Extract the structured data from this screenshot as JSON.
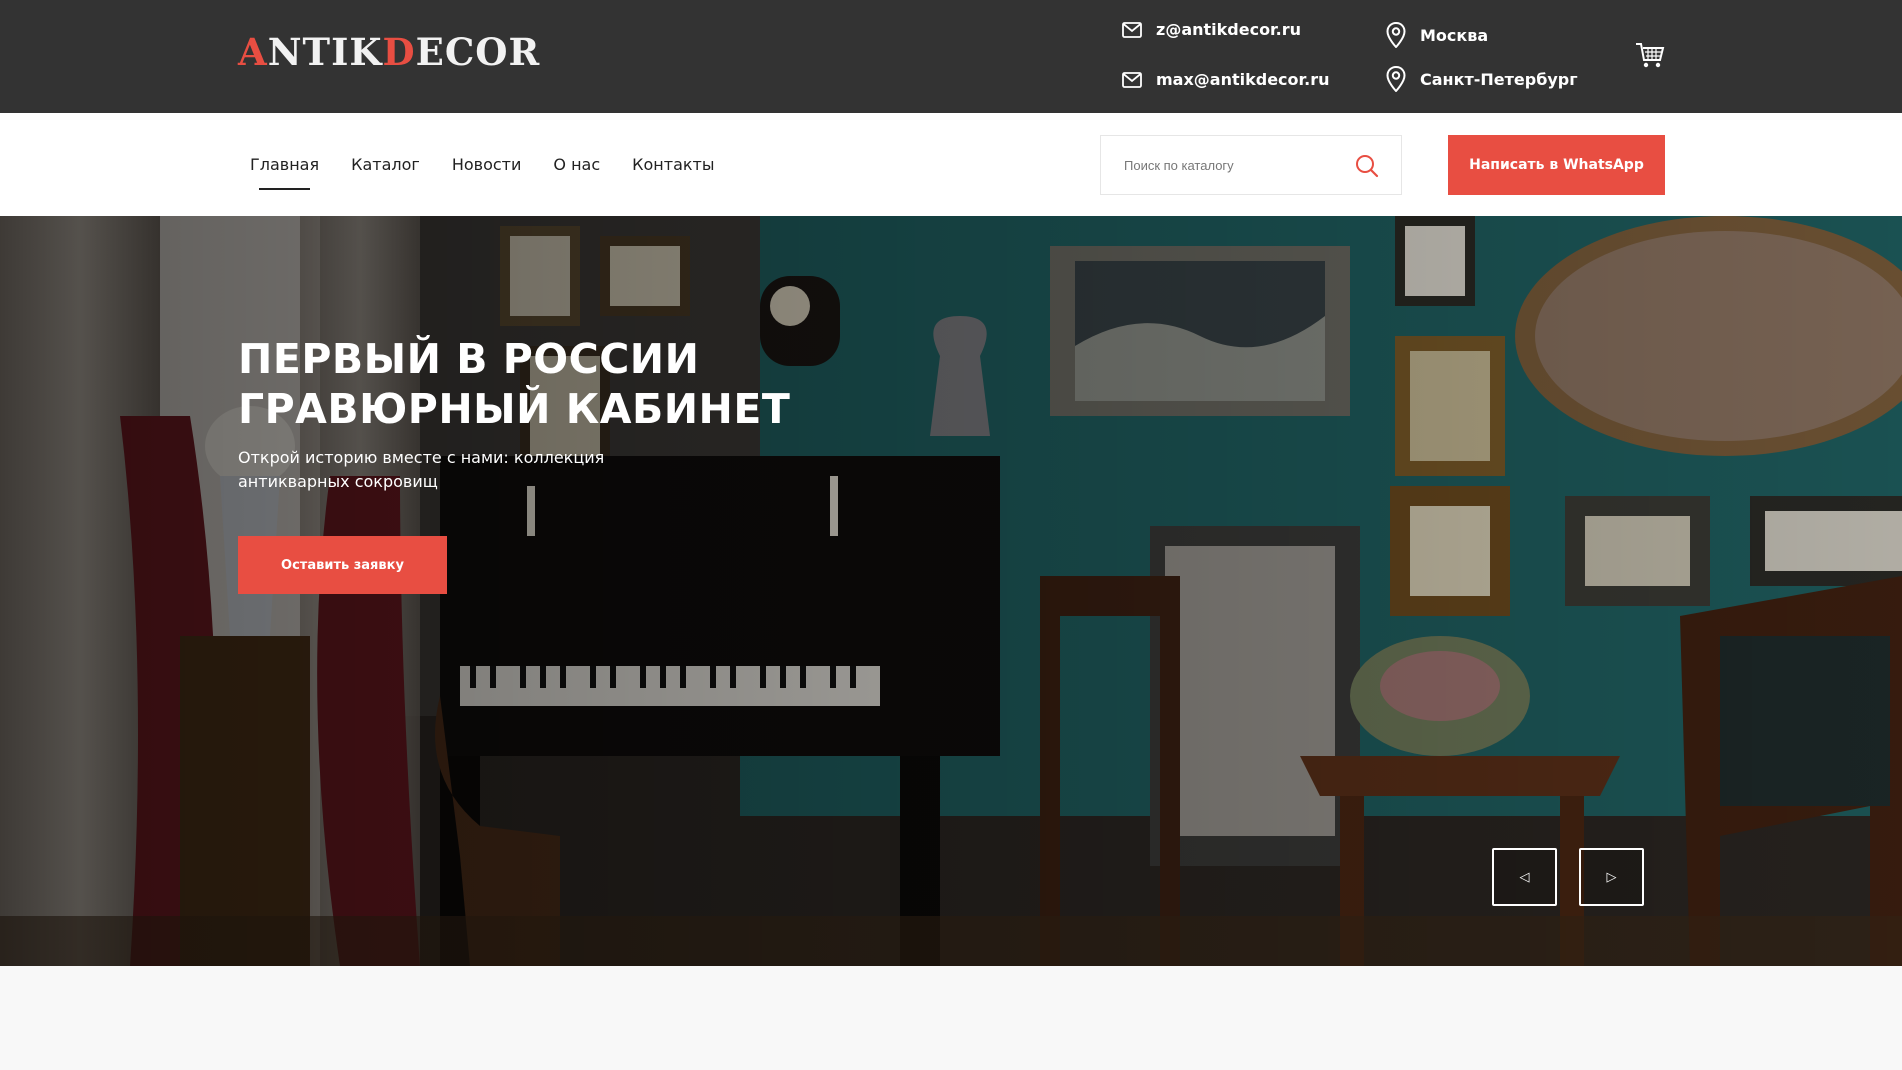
{
  "header": {
    "logo": {
      "first": "A",
      "part1": "NTIK",
      "mid": "D",
      "part2": "ECOR"
    },
    "emails": [
      "z@antikdecor.ru",
      "max@antikdecor.ru"
    ],
    "cities": [
      "Москва",
      "Санкт-Петербург"
    ],
    "icons": {
      "email": "mail-icon",
      "city": "location-pin-icon",
      "cart": "cart-icon"
    }
  },
  "nav": {
    "items": [
      {
        "label": "Главная",
        "active": true
      },
      {
        "label": "Каталог",
        "active": false
      },
      {
        "label": "Новости",
        "active": false
      },
      {
        "label": "О нас",
        "active": false
      },
      {
        "label": "Контакты",
        "active": false
      }
    ],
    "search_placeholder": "Поиск по каталогу",
    "whatsapp_label": "Написать в WhatsApp"
  },
  "hero": {
    "title": "ПЕРВЫЙ В РОССИИ ГРАВЮРНЫЙ КАБИНЕТ",
    "subtitle": "Открой историю вместе с нами: коллекция антикварных сокровищ",
    "cta_label": "Оставить заявку",
    "prev_symbol": "◁",
    "next_symbol": "▷"
  },
  "colors": {
    "accent": "#e84e42",
    "topbar": "#333333",
    "wall": "#1e5a5a"
  }
}
